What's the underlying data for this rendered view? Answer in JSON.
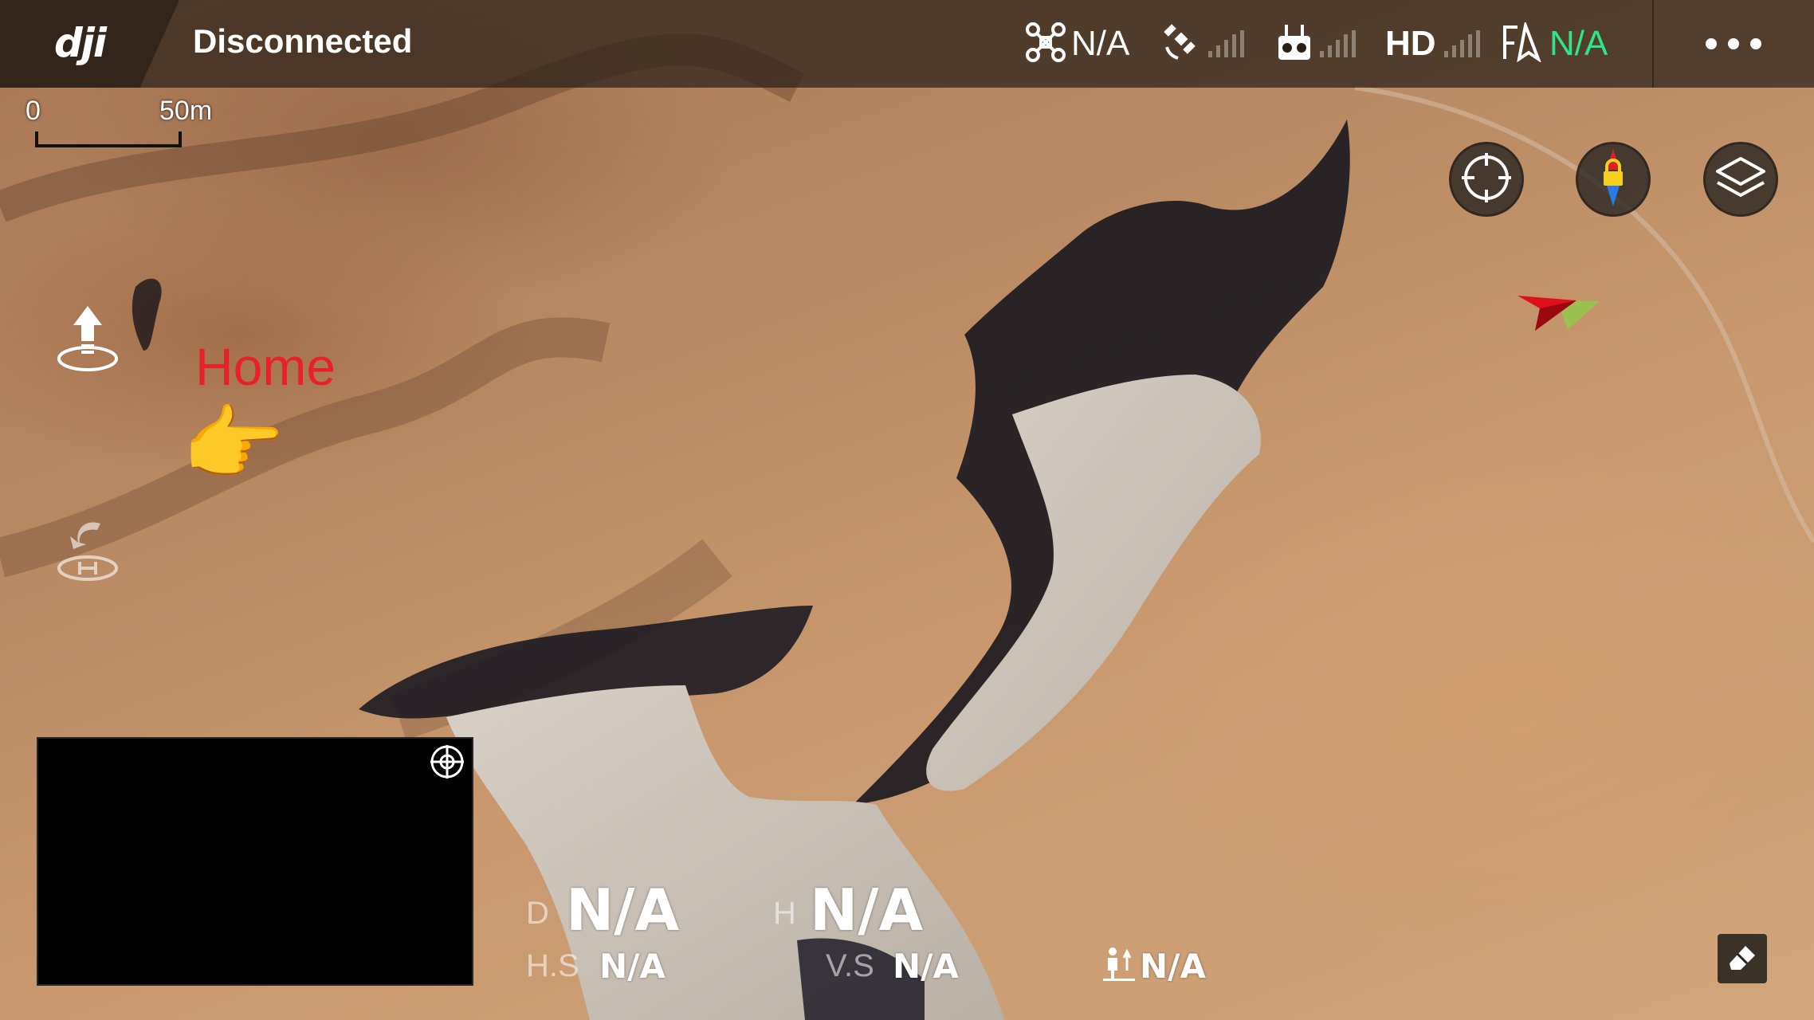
{
  "topbar": {
    "logo": "dji",
    "status": "Disconnected",
    "aircraft_status": {
      "icon": "aircraft-icon",
      "value": "N/A"
    },
    "gps_signal": {
      "icon": "satellite-icon"
    },
    "rc_signal": {
      "icon": "remote-controller-icon"
    },
    "hd_signal": {
      "label": "HD"
    },
    "battery": {
      "icon": "flight-mode-icon",
      "value": "N/A",
      "color": "#2ee58a"
    },
    "more_icon": "more-dots-icon"
  },
  "scale": {
    "zero_label": "0",
    "max_label": "50m"
  },
  "map_buttons": {
    "locate_icon": "crosshair-icon",
    "compass_icon": "compass-lock-icon",
    "layers_icon": "layers-icon"
  },
  "left_buttons": {
    "takeoff_icon": "takeoff-icon",
    "return_home_icon": "return-home-icon"
  },
  "annotation": {
    "home_label": "Home",
    "home_color": "#e8202a",
    "pointer": "👉"
  },
  "telemetry": {
    "distance": {
      "label": "D",
      "value": "N/A"
    },
    "height": {
      "label": "H",
      "value": "N/A"
    },
    "horizontal_speed": {
      "label": "H.S",
      "value": "N/A"
    },
    "vertical_speed": {
      "label": "V.S",
      "value": "N/A"
    },
    "distance_to_pilot": {
      "icon": "pilot-distance-icon",
      "value": "N/A"
    }
  },
  "fpv": {
    "target_icon": "focus-target-icon"
  },
  "eraser_icon": "eraser-icon"
}
